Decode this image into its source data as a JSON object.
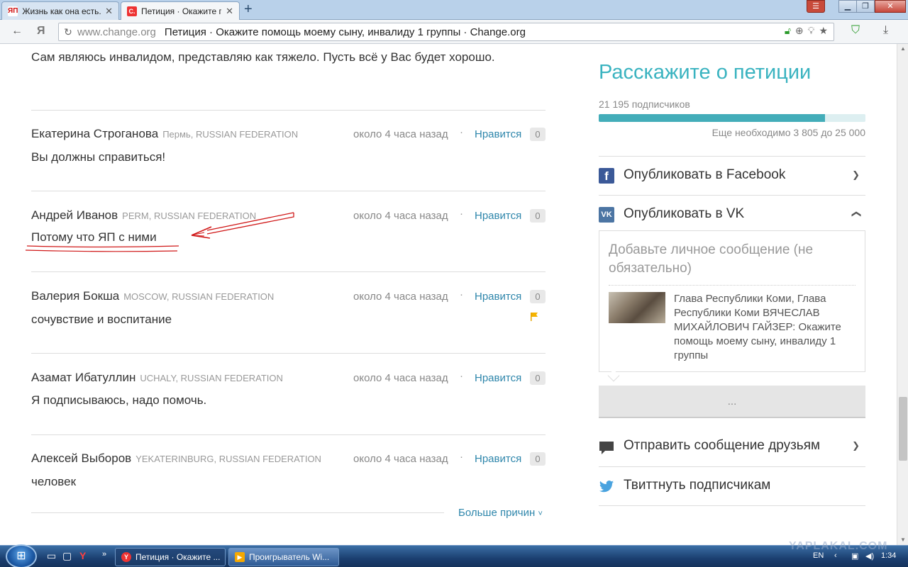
{
  "browser": {
    "tabs": [
      {
        "favicon": "ЯП",
        "title": "Жизнь как она есть..."
      },
      {
        "favicon": "С.",
        "title": "Петиция · Окажите по"
      }
    ],
    "address": {
      "domain": "www.change.org",
      "page_title": "Петиция · Окажите помощь моему сыну, инвалиду 1 группы · Change.org"
    }
  },
  "content": {
    "first_comment": "Сам являюсь инвалидом, представляю как тяжело. Пусть всё у Вас будет хорошо.",
    "comments": [
      {
        "name": "Екатерина Строганова",
        "location": "Пермь, RUSSIAN FEDERATION",
        "time": "около 4 часа назад",
        "like": "Нравится",
        "count": "0",
        "text": "Вы должны справиться!",
        "flag": false
      },
      {
        "name": "Андрей Иванов",
        "location": "PERM, RUSSIAN FEDERATION",
        "time": "около 4 часа назад",
        "like": "Нравится",
        "count": "0",
        "text": "Потому что ЯП с ними",
        "flag": false
      },
      {
        "name": "Валерия Бокша",
        "location": "MOSCOW, RUSSIAN FEDERATION",
        "time": "около 4 часа назад",
        "like": "Нравится",
        "count": "0",
        "text": "сочувствие и воспитание",
        "flag": true
      },
      {
        "name": "Азамат Ибатуллин",
        "location": "UCHALY, RUSSIAN FEDERATION",
        "time": "около 4 часа назад",
        "like": "Нравится",
        "count": "0",
        "text": "Я подписываюсь, надо помочь.",
        "flag": false
      },
      {
        "name": "Алексей Выборов",
        "location": "YEKATERINBURG, RUSSIAN FEDERATION",
        "time": "около 4 часа назад",
        "like": "Нравится",
        "count": "0",
        "text": "человек",
        "flag": false
      }
    ],
    "more_reasons": "Больше причин"
  },
  "sidebar": {
    "title": "Расскажите о петиции",
    "signers": "21 195 подписчиков",
    "progress_fraction": 0.848,
    "needed": "Еще необходимо 3 805 до 25 000",
    "facebook_label": "Опубликовать в Facebook",
    "vk_label": "Опубликовать в VK",
    "vk_message_placeholder": "Добавьте личное сообщение (не обязательно)",
    "vk_preview_text": "Глава Республики Коми, Глава Республики Коми ВЯЧЕСЛАВ МИХАЙЛОВИЧ ГАЙЗЕР: Окажите помощь моему сыну, инвалиду 1 группы",
    "vk_button": "...",
    "message_friends": "Отправить сообщение друзьям",
    "tweet": "Твиттнуть подписчикам",
    "accent_color": "#3ab3c0",
    "link_color": "#2e86ab"
  },
  "taskbar": {
    "items": [
      {
        "title": "Петиция · Окажите ..."
      },
      {
        "title": "Проигрыватель Wi..."
      }
    ],
    "lang": "EN",
    "clock": "1:34",
    "watermark": "YAPLAKAL.COM"
  }
}
